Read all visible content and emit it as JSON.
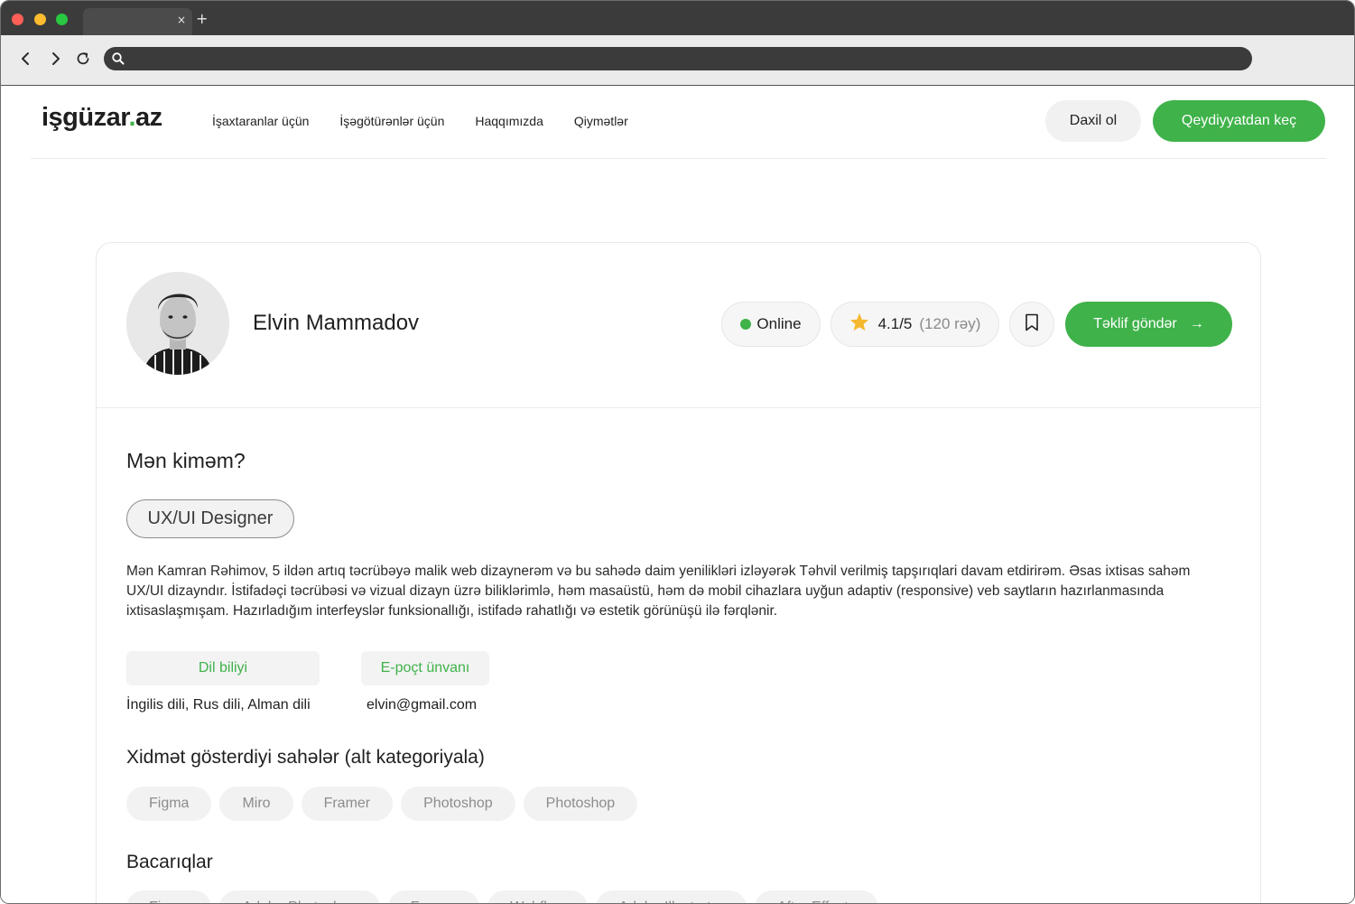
{
  "browser": {
    "tab_close": "×",
    "new_tab": "+"
  },
  "site": {
    "logo_main": "işgüzar",
    "logo_dot": ".",
    "logo_tld": "az",
    "nav": [
      "İşaxtaranlar üçün",
      "İşəgötürənlər üçün",
      "Haqqımızda",
      "Qiymətlər"
    ],
    "login_label": "Daxil ol",
    "signup_label": "Qeydiyyatdan keç"
  },
  "profile": {
    "name": "Elvin Mammadov",
    "status": "Online",
    "rating": "4.1/5",
    "reviews": "(120 rəy)",
    "offer_label": "Təklif göndər",
    "offer_arrow": "→",
    "about_title": "Mən kiməm?",
    "role": "UX/UI Designer",
    "about_text": "Mən Kamran Rəhimov, 5 ildən artıq təcrübəyə malik web dizaynerəm və bu sahədə daim yenilikləri izləyərək Təhvil verilmiş tapşırıqlari davam etdirirəm. Əsas ixtisas sahəm UX/UI dizayndır. İstifadəçi təcrübəsi və vizual dizayn üzrə biliklərimlə, həm masaüstü, həm də mobil cihazlara uyğun adaptiv (responsive) veb saytların hazırlanmasında ixtisaslaşmışam. Hazırladığım interfeyslər funksionallığı, istifadə rahatlığı və estetik görünüşü ilə fərqlənir.",
    "lang_label": "Dil biliyi",
    "lang_value": "İngilis dili, Rus dili, Alman dili",
    "email_label": "E-poçt ünvanı",
    "email_value": "elvin@gmail.com",
    "services_title": "Xidmət gösterdiyi sahələr (alt kategoriyala)",
    "services": [
      "Figma",
      "Miro",
      "Framer",
      "Photoshop",
      "Photoshop"
    ],
    "skills_title": "Bacarıqlar",
    "skills": [
      "Figma",
      "Adobe Photoshop",
      "Framer",
      "Webflow",
      "Adobe Illustrator",
      "After Effects"
    ]
  },
  "colors": {
    "accent": "#3fb24a",
    "star": "#f5b82e"
  },
  "icons": {
    "back": "chevron-left-icon",
    "forward": "chevron-right-icon",
    "reload": "reload-icon",
    "search": "search-icon",
    "star": "star-icon",
    "bookmark": "bookmark-icon",
    "arrow": "arrow-right-icon"
  }
}
